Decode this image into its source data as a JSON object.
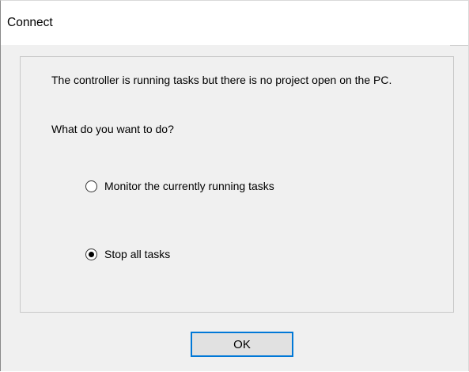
{
  "window": {
    "title": "Connect"
  },
  "dialog": {
    "message": "The controller is running tasks but there is no project open on the PC.",
    "question": "What do you want to do?",
    "options": [
      {
        "label": "Monitor the currently running tasks",
        "selected": false
      },
      {
        "label": "Stop all tasks",
        "selected": true
      }
    ],
    "ok_label": "OK"
  },
  "colors": {
    "accent": "#0078d7",
    "background": "#f0f0f0",
    "titlebar": "#ffffff"
  }
}
